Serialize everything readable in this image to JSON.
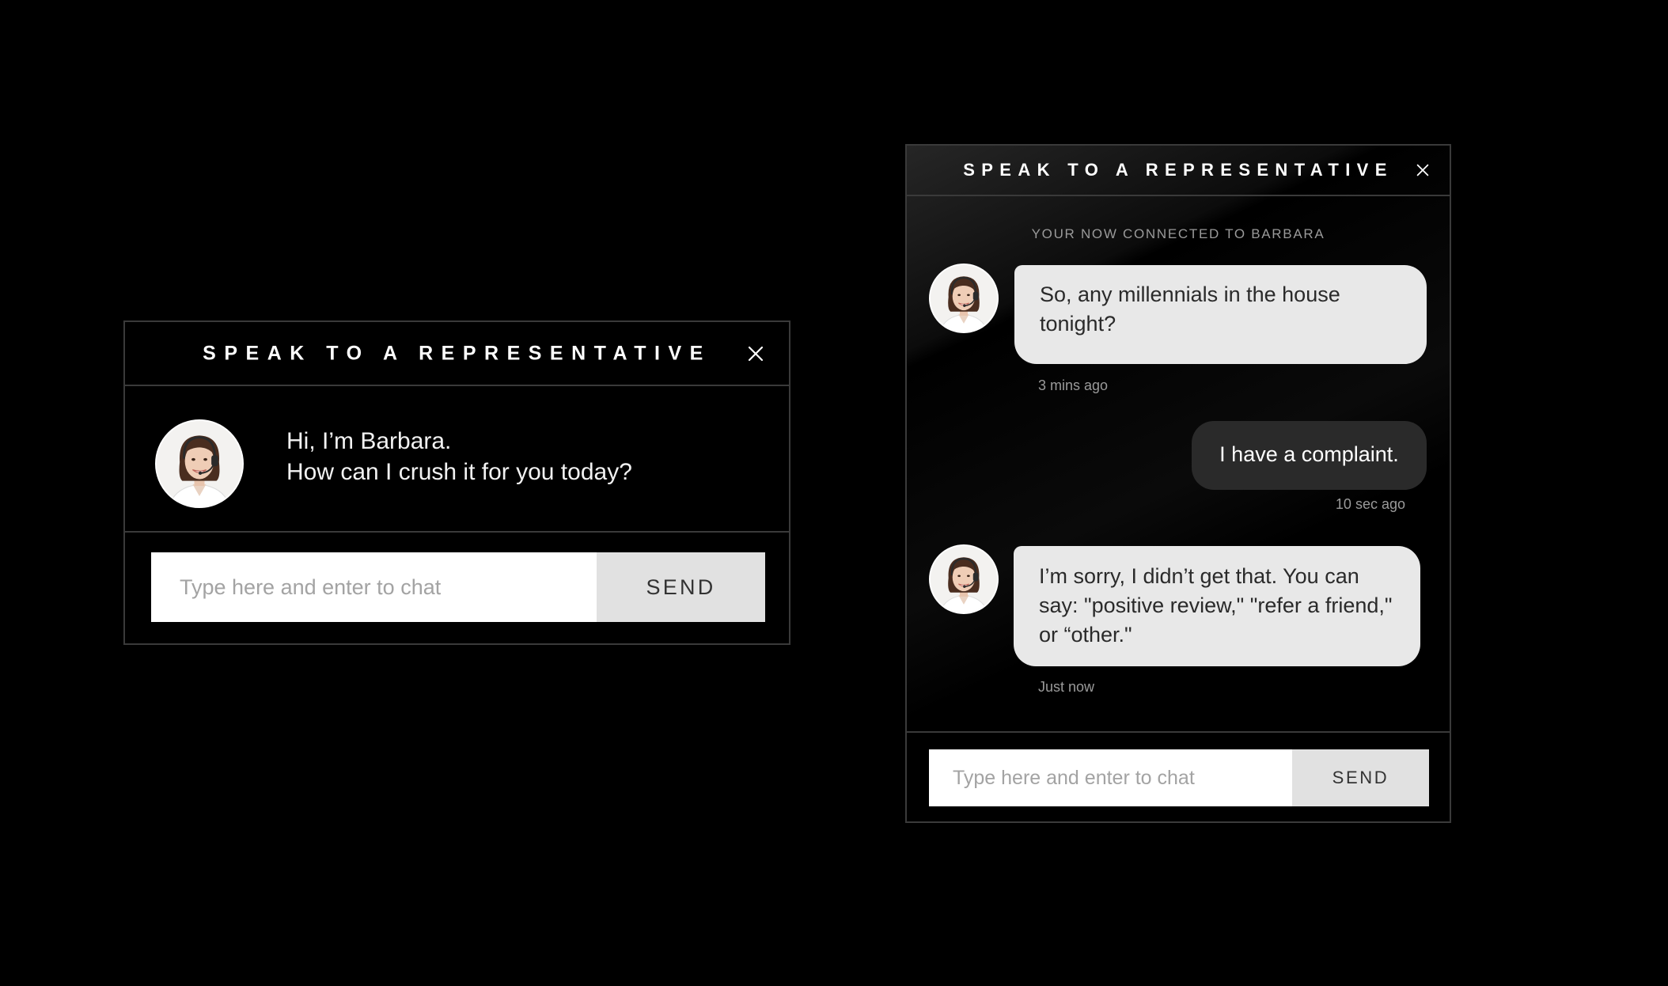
{
  "welcome_widget": {
    "title": "SPEAK TO A REPRESENTATIVE",
    "greeting_line1": "Hi, I’m Barbara.",
    "greeting_line2": "How can I crush it for you today?",
    "input_placeholder": "Type here and enter to chat",
    "send_label": "SEND"
  },
  "chat_widget": {
    "title": "SPEAK TO A REPRESENTATIVE",
    "status": "YOUR NOW CONNECTED TO BARBARA",
    "messages": [
      {
        "from": "agent",
        "text": "So, any millennials in the house tonight?",
        "time": "3 mins ago"
      },
      {
        "from": "user",
        "text": "I have a complaint.",
        "time": "10 sec ago"
      },
      {
        "from": "agent",
        "text": "I’m sorry, I didn’t get that. You can say: \"positive review,\" \"refer a friend,\" or “other.\"",
        "time": "Just now"
      }
    ],
    "input_placeholder": "Type here and enter to chat",
    "send_label": "SEND"
  },
  "colors": {
    "background": "#000000",
    "border": "#3a3a3a",
    "agent_bubble": "#e8e8e8",
    "user_bubble": "#2a2a2a",
    "send_button": "#e1e1e1"
  },
  "icons": [
    "close-icon",
    "agent-avatar"
  ]
}
